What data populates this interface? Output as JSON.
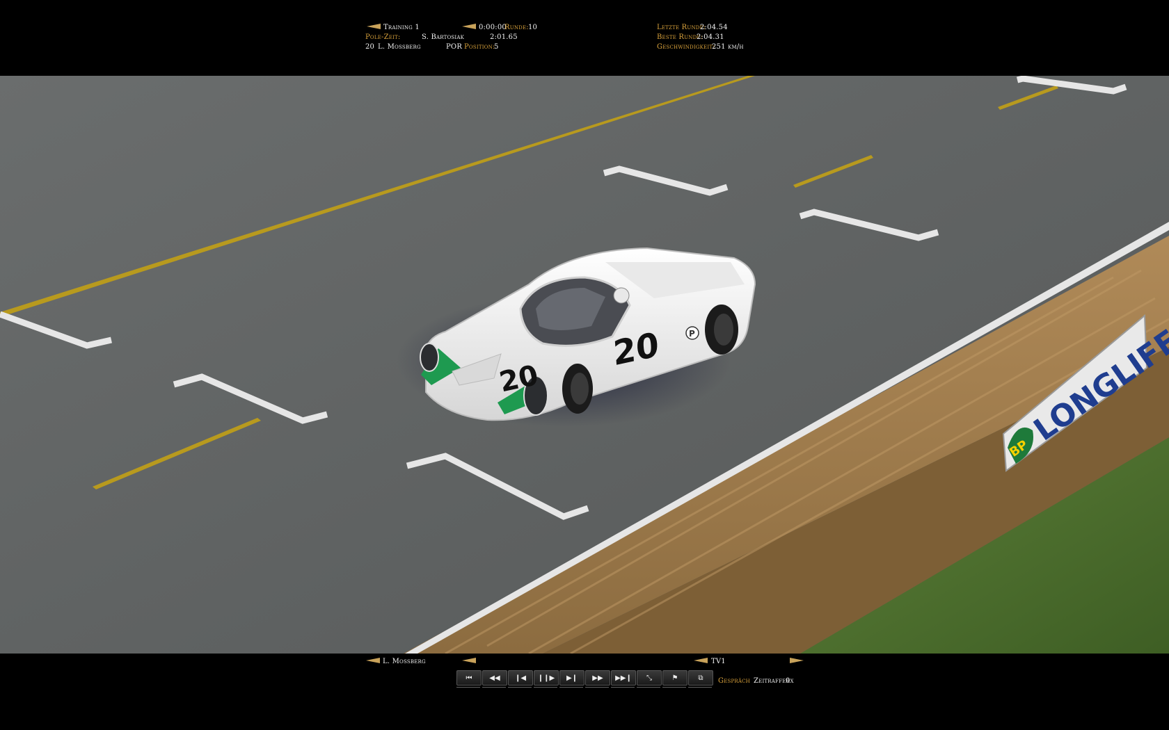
{
  "top_hud": {
    "session": "Training 1",
    "session_time": "0:00:00",
    "lap_label": "Runde:",
    "lap_value": "10",
    "pole_label": "Pole-Zeit:",
    "pole_driver": "S. Bartosiak",
    "pole_time": "2:01.65",
    "car_number": "20",
    "driver_name": "L. Mossberg",
    "team": "POR",
    "position_label": "Position:",
    "position_value": "5",
    "last_lap_label": "Letzte Runde:",
    "last_lap_value": "2:04.54",
    "best_lap_label": "Beste Runde:",
    "best_lap_value": "2:04.31",
    "speed_label": "Geschwindigkeit:",
    "speed_value": "251 km/h"
  },
  "scene": {
    "car_number": "20",
    "car_badge": "P",
    "banner_logo": "BP",
    "banner_text": "LONGLIFE",
    "colors": {
      "asphalt": "#5f6262",
      "yellow_line": "#b89a1e",
      "white_line": "#e6e6e6",
      "car_body": "#f2f2f2",
      "car_green": "#1e9a50",
      "hay": "#a88352",
      "grass": "#4e7230",
      "banner_blue": "#1f3d8f"
    }
  },
  "bottom_hud": {
    "driver_name": "L. Mossberg",
    "camera": "TV1",
    "controls": [
      {
        "icon": "skip-start-icon",
        "glyph": "⏮"
      },
      {
        "icon": "rewind-icon",
        "glyph": "◀◀"
      },
      {
        "icon": "step-back-icon",
        "glyph": "❙◀"
      },
      {
        "icon": "pause-icon",
        "glyph": "❙❙▶"
      },
      {
        "icon": "step-forward-icon",
        "glyph": "▶❙"
      },
      {
        "icon": "fast-forward-icon",
        "glyph": "▶▶"
      },
      {
        "icon": "skip-end-icon",
        "glyph": "▶▶❙"
      },
      {
        "icon": "camera-switch-icon",
        "glyph": "⤡"
      },
      {
        "icon": "flag-icon",
        "glyph": "⚑"
      },
      {
        "icon": "export-icon",
        "glyph": "⧉"
      }
    ],
    "chat_label": "Gespräch",
    "timelapse_label": "Zeitraffer",
    "timelapse_value": "0x"
  }
}
